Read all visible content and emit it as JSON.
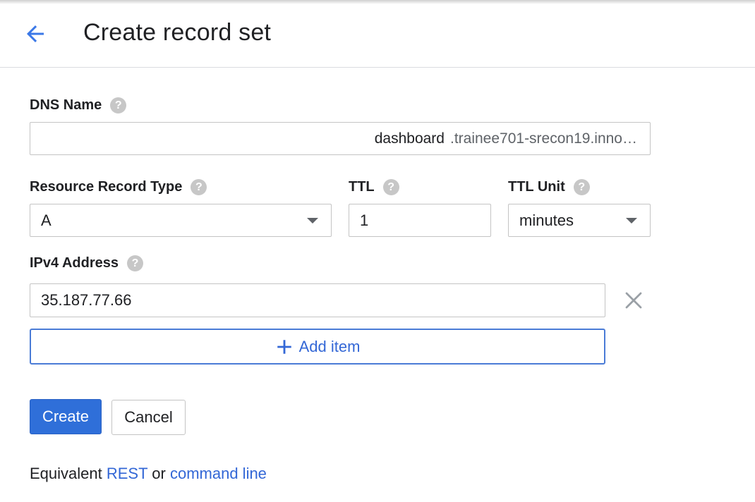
{
  "header": {
    "title": "Create record set",
    "back_icon": "arrow-back-icon"
  },
  "dns_name": {
    "label": "DNS Name",
    "value": "dashboard",
    "suffix": ".trainee701-srecon19.inno…"
  },
  "record_type": {
    "label": "Resource Record Type",
    "selected": "A"
  },
  "ttl": {
    "label": "TTL",
    "value": "1"
  },
  "ttl_unit": {
    "label": "TTL Unit",
    "selected": "minutes"
  },
  "ipv4": {
    "label": "IPv4 Address",
    "items": [
      "35.187.77.66"
    ],
    "add_item_label": "Add item"
  },
  "actions": {
    "create_label": "Create",
    "cancel_label": "Cancel"
  },
  "footer": {
    "prefix": "Equivalent",
    "rest_link": "REST",
    "or_text": "or",
    "cli_link": "command line"
  },
  "help_glyph": "?",
  "colors": {
    "accent": "#3367d6",
    "primary_button": "#2f6fd9",
    "help_icon": "#c7c7c7",
    "border": "#c4c4c4"
  }
}
